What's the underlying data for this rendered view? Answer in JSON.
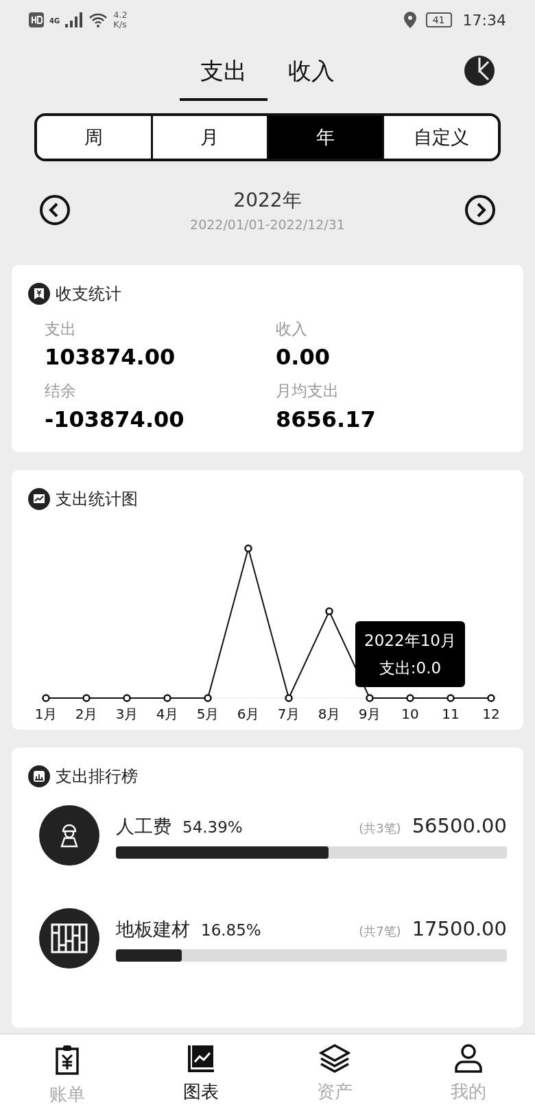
{
  "status_bar": {
    "network": "4G",
    "speed": "4.2",
    "speed_unit": "K/s",
    "battery": "41",
    "time": "17:34"
  },
  "type_tabs": [
    {
      "label": "支出",
      "selected": true
    },
    {
      "label": "收入",
      "selected": false
    }
  ],
  "period_tabs": [
    {
      "label": "周",
      "selected": false
    },
    {
      "label": "月",
      "selected": false
    },
    {
      "label": "年",
      "selected": true
    },
    {
      "label": "自定义",
      "selected": false
    }
  ],
  "date_nav": {
    "title": "2022年",
    "range": "2022/01/01-2022/12/31"
  },
  "summary": {
    "title": "收支统计",
    "items": [
      {
        "label": "支出",
        "value": "103874.00"
      },
      {
        "label": "收入",
        "value": "0.00"
      },
      {
        "label": "结余",
        "value": "-103874.00"
      },
      {
        "label": "月均支出",
        "value": "8656.17"
      }
    ]
  },
  "trend": {
    "title": "支出统计图",
    "x_labels": [
      "1月",
      "2月",
      "3月",
      "4月",
      "5月",
      "6月",
      "7月",
      "8月",
      "9月",
      "10",
      "11",
      "12"
    ],
    "tooltip": {
      "title": "2022年10月",
      "value": "支出:0.0"
    }
  },
  "ranking": {
    "title": "支出排行榜",
    "items": [
      {
        "kind": "worker",
        "name": "人工费",
        "percent": "54.39%",
        "count": "(共3笔)",
        "amount": "56500.00",
        "level": 0.5439
      },
      {
        "kind": "floor",
        "name": "地板建材",
        "percent": "16.85%",
        "count": "(共7笔)",
        "amount": "17500.00",
        "level": 0.1685
      }
    ]
  },
  "bottom_nav": [
    {
      "kind": "bill",
      "label": "账单",
      "selected": false
    },
    {
      "kind": "chart",
      "label": "图表",
      "selected": true
    },
    {
      "kind": "assets",
      "label": "资产",
      "selected": false
    },
    {
      "kind": "me",
      "label": "我的",
      "selected": false
    }
  ]
}
